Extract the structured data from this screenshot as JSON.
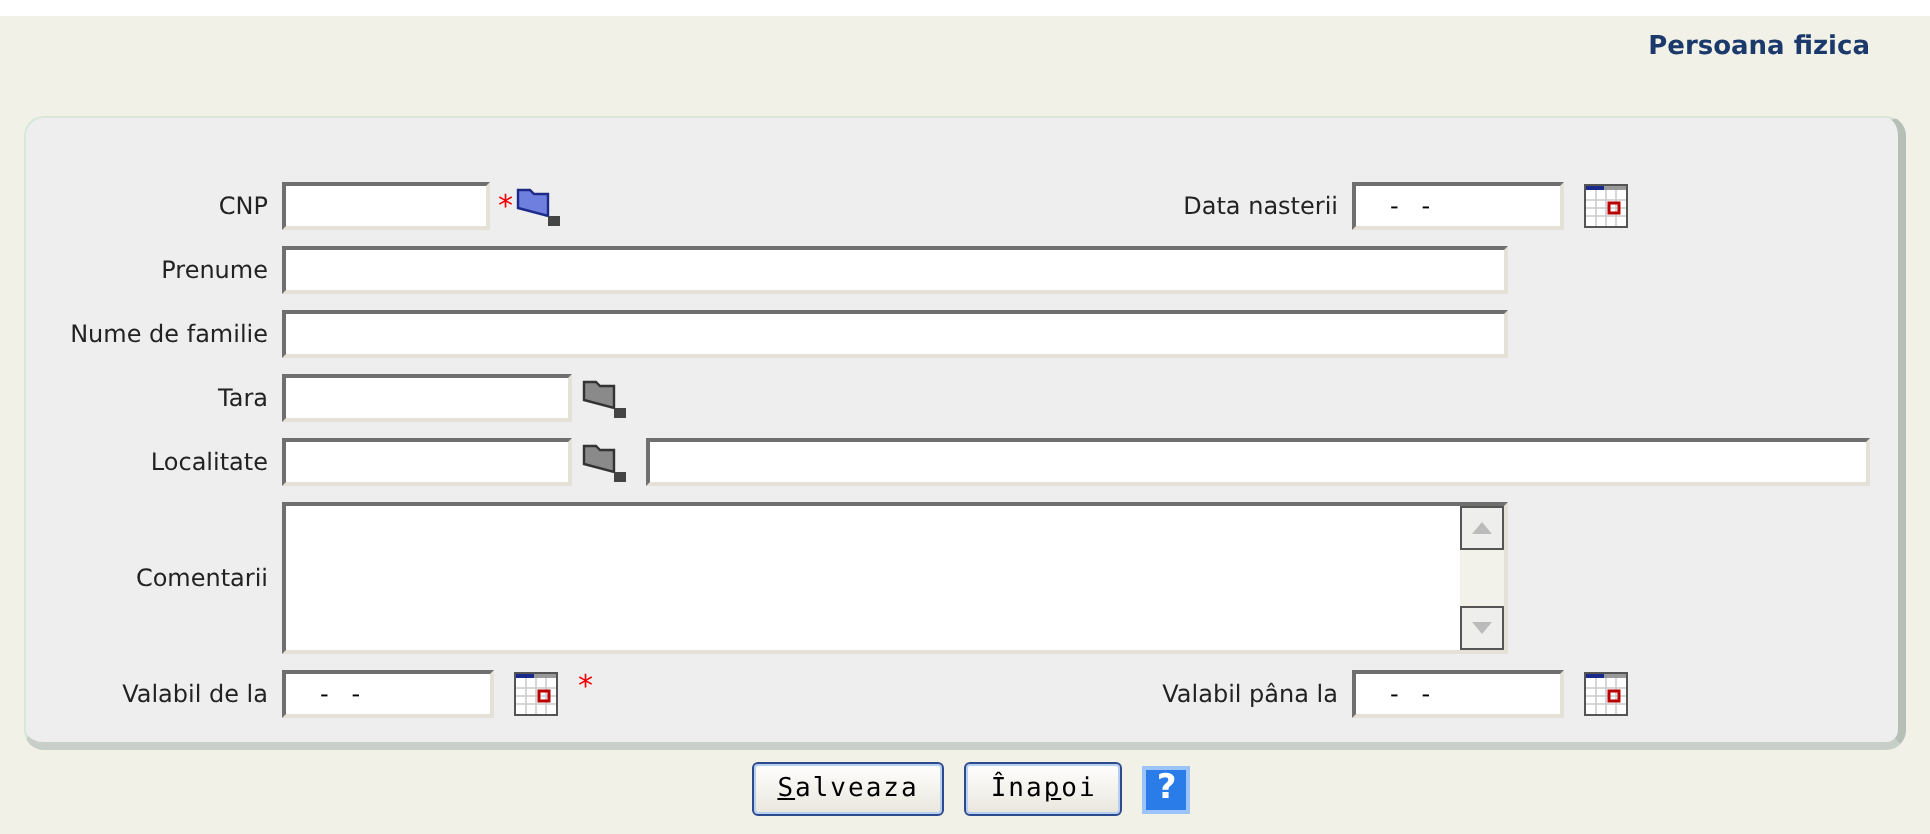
{
  "title": "Persoana fizica",
  "rows": [
    {
      "items": [
        {
          "kind": "short",
          "label": "CNP",
          "mark": "*",
          "lookup": true,
          "highlighted": true
        }
      ],
      "aside": {
        "kind": "date",
        "label": "Data nasterii",
        "value": "-   -"
      }
    },
    {
      "items": [
        {
          "kind": "long",
          "label": "Prenume",
          "lookup": false
        }
      ]
    },
    {
      "items": [
        {
          "kind": "long",
          "label": "Nume de familie",
          "lookup": false
        }
      ]
    },
    {
      "items": [
        {
          "kind": "medium",
          "label": "Tara",
          "lookup": true,
          "highlighted": false
        }
      ]
    },
    {
      "items": [
        {
          "kind": "medium",
          "label": "Localitate",
          "lookup": true,
          "highlighted": false
        },
        {
          "kind": "wide",
          "lookup": false
        }
      ]
    },
    {
      "items": [
        {
          "kind": "textarea",
          "label": "Comentarii"
        }
      ]
    },
    {
      "items": [
        {
          "kind": "date",
          "label": "Valabil de la",
          "value": "-   -",
          "mark": "*"
        }
      ],
      "aside": {
        "kind": "date",
        "label": "Valabil pâna la",
        "value": "-   -"
      }
    }
  ],
  "buttons": [
    {
      "kind": "text",
      "key": "S",
      "after": "alveaza"
    },
    {
      "kind": "text",
      "before": "Îna",
      "key": "p",
      "after": "oi"
    },
    {
      "kind": "help",
      "before": "?"
    }
  ]
}
